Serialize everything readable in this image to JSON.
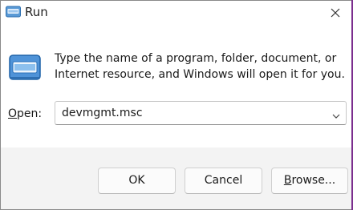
{
  "window": {
    "title": "Run"
  },
  "dialog": {
    "description": "Type the name of a program, folder, document, or Internet resource, and Windows will open it for you.",
    "open_label_underlined": "O",
    "open_label_rest": "pen:",
    "open_value": "devmgmt.msc"
  },
  "buttons": {
    "ok": "OK",
    "cancel": "Cancel",
    "browse_underlined": "B",
    "browse_rest": "rowse..."
  },
  "icons": {
    "title": "run-app-icon",
    "main": "run-app-icon",
    "close": "close-icon",
    "dropdown": "chevron-down-icon"
  },
  "colors": {
    "accent": "#0067c0",
    "footer_background": "#f3f3f3",
    "window_edge": "#7b2e8e"
  }
}
